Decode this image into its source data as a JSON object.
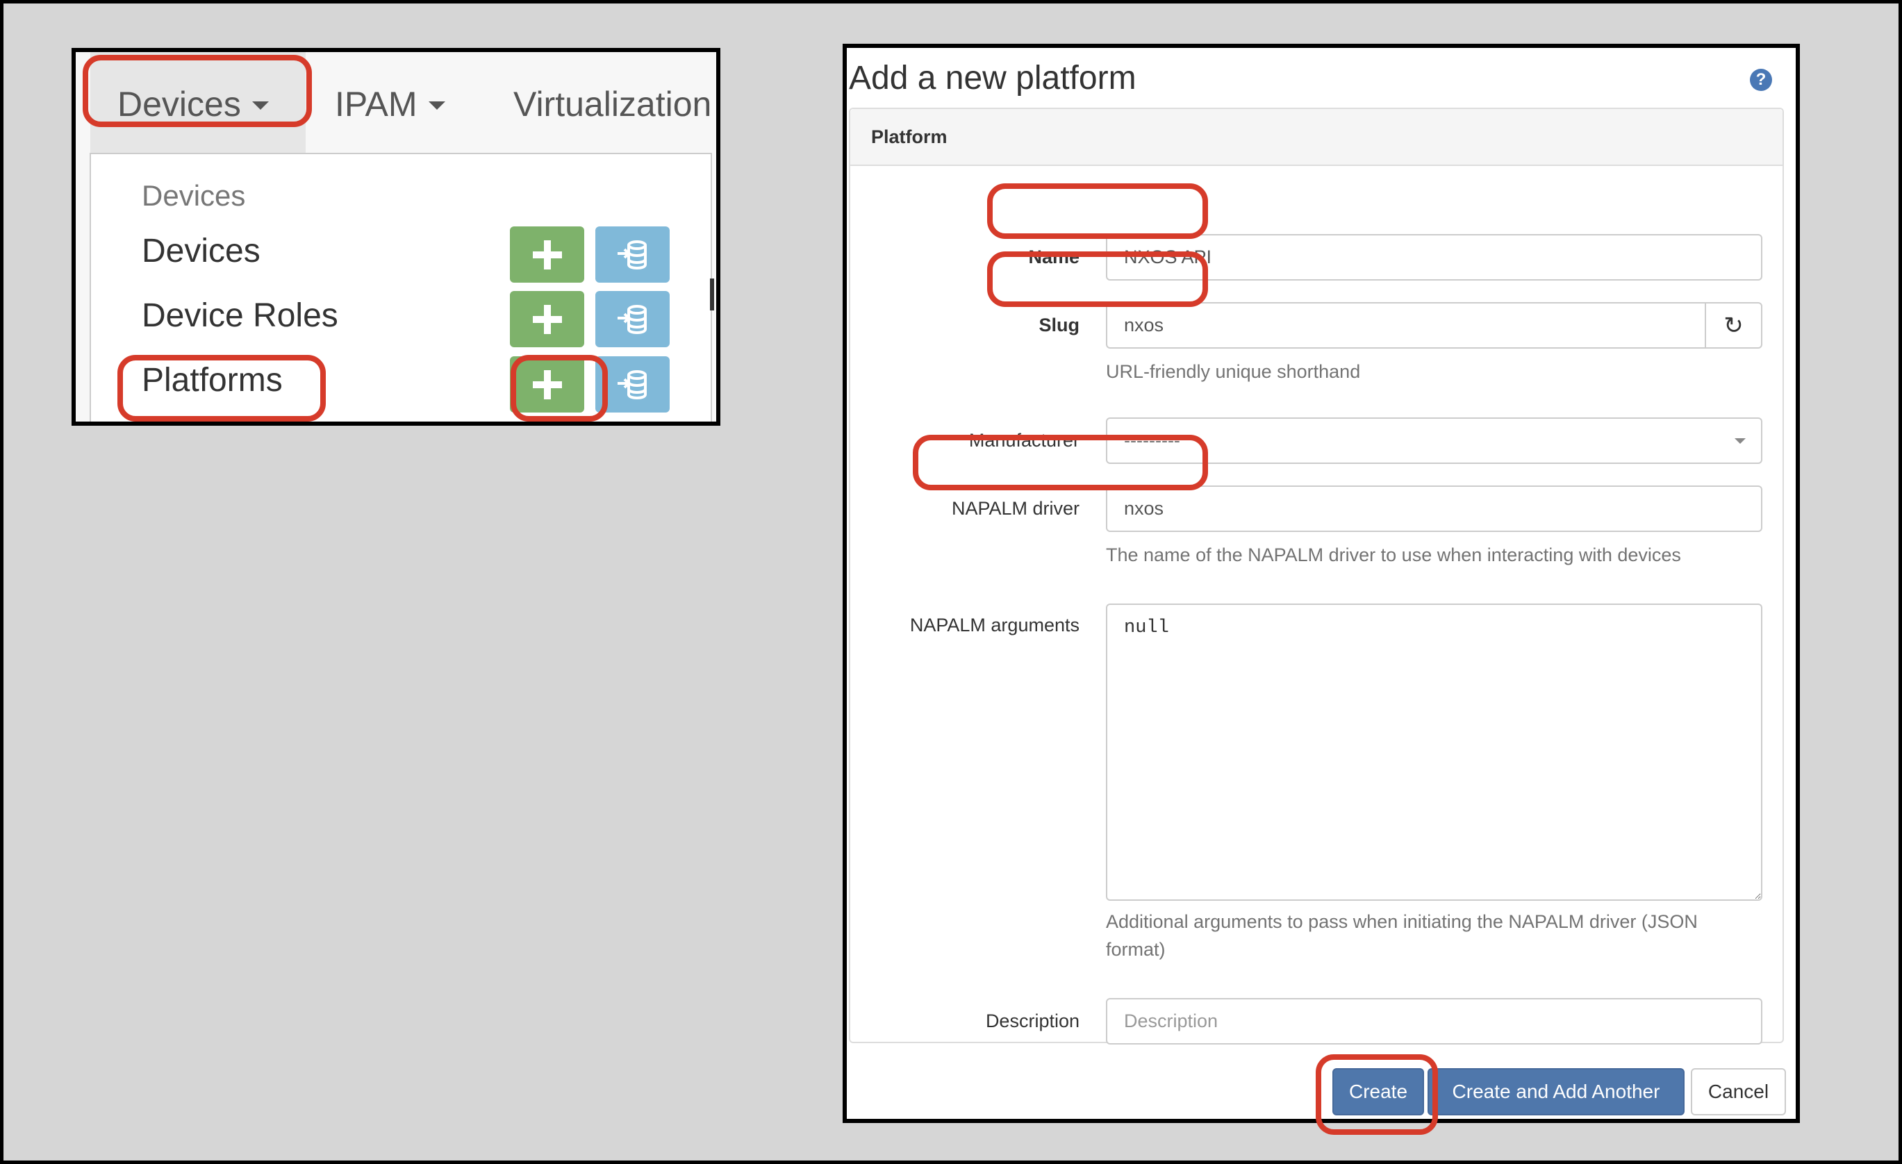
{
  "navbar": {
    "tabs": [
      {
        "label": "Devices",
        "has_caret": true,
        "active": true
      },
      {
        "label": "IPAM",
        "has_caret": true,
        "active": false
      },
      {
        "label": "Virtualization",
        "has_caret": false,
        "active": false
      }
    ]
  },
  "dropdown": {
    "section_header": "Devices",
    "items": [
      {
        "label": "Devices",
        "add_icon": "plus-icon",
        "import_icon": "database-import-icon"
      },
      {
        "label": "Device Roles",
        "add_icon": "plus-icon",
        "import_icon": "database-import-icon"
      },
      {
        "label": "Platforms",
        "add_icon": "plus-icon",
        "import_icon": "database-import-icon"
      }
    ]
  },
  "form": {
    "title": "Add a new platform",
    "help_icon": "?",
    "panel_heading": "Platform",
    "fields": {
      "name": {
        "label": "Name",
        "value": "NXOS API"
      },
      "slug": {
        "label": "Slug",
        "value": "nxos",
        "help": "URL-friendly unique shorthand",
        "regen_icon": "↻"
      },
      "manufacturer": {
        "label": "Manufacturer",
        "value": "---------"
      },
      "napalm_driver": {
        "label": "NAPALM driver",
        "value": "nxos",
        "help": "The name of the NAPALM driver to use when interacting with devices"
      },
      "napalm_args": {
        "label": "NAPALM arguments",
        "value": "null",
        "help": "Additional arguments to pass when initiating the NAPALM driver (JSON format)"
      },
      "description": {
        "label": "Description",
        "value": "",
        "placeholder": "Description"
      }
    },
    "buttons": {
      "create": "Create",
      "create_another": "Create and Add Another",
      "cancel": "Cancel"
    }
  },
  "colors": {
    "annotation": "#d63b2a",
    "primary": "#4f77ab",
    "add_green": "#7eb26b",
    "import_blue": "#80b9d9"
  }
}
